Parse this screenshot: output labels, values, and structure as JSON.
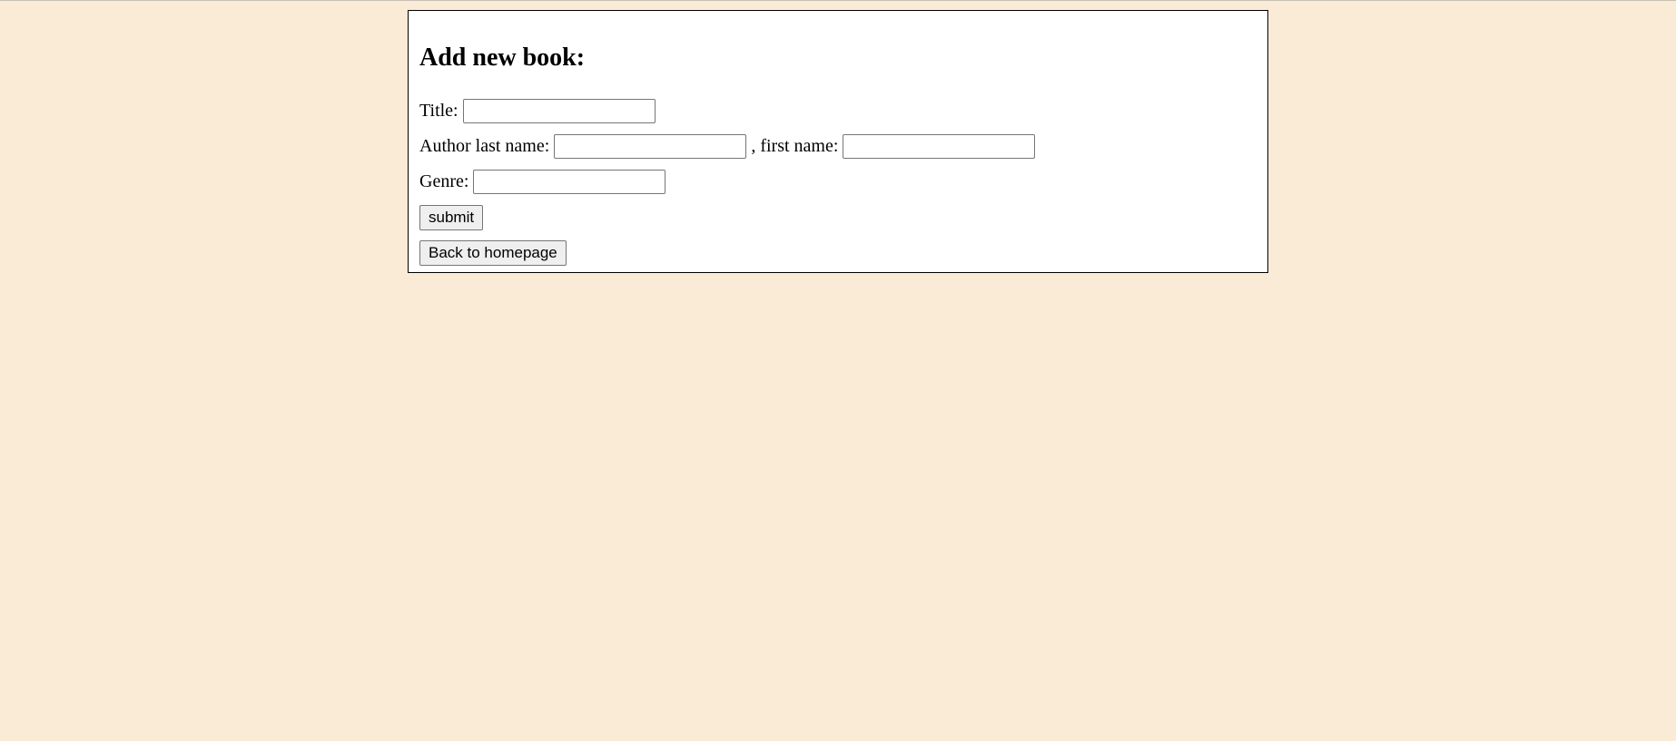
{
  "page": {
    "heading": "Add new book:"
  },
  "form": {
    "title_label": "Title:",
    "author_last_label": "Author last name:",
    "author_first_label": ", first name:",
    "genre_label": "Genre:",
    "title_value": "",
    "author_last_value": "",
    "author_first_value": "",
    "genre_value": "",
    "submit_label": "submit",
    "back_label": "Back to homepage"
  },
  "colors": {
    "background": "#FAEBD7",
    "panel": "#FFFFFF",
    "border": "#000000"
  }
}
